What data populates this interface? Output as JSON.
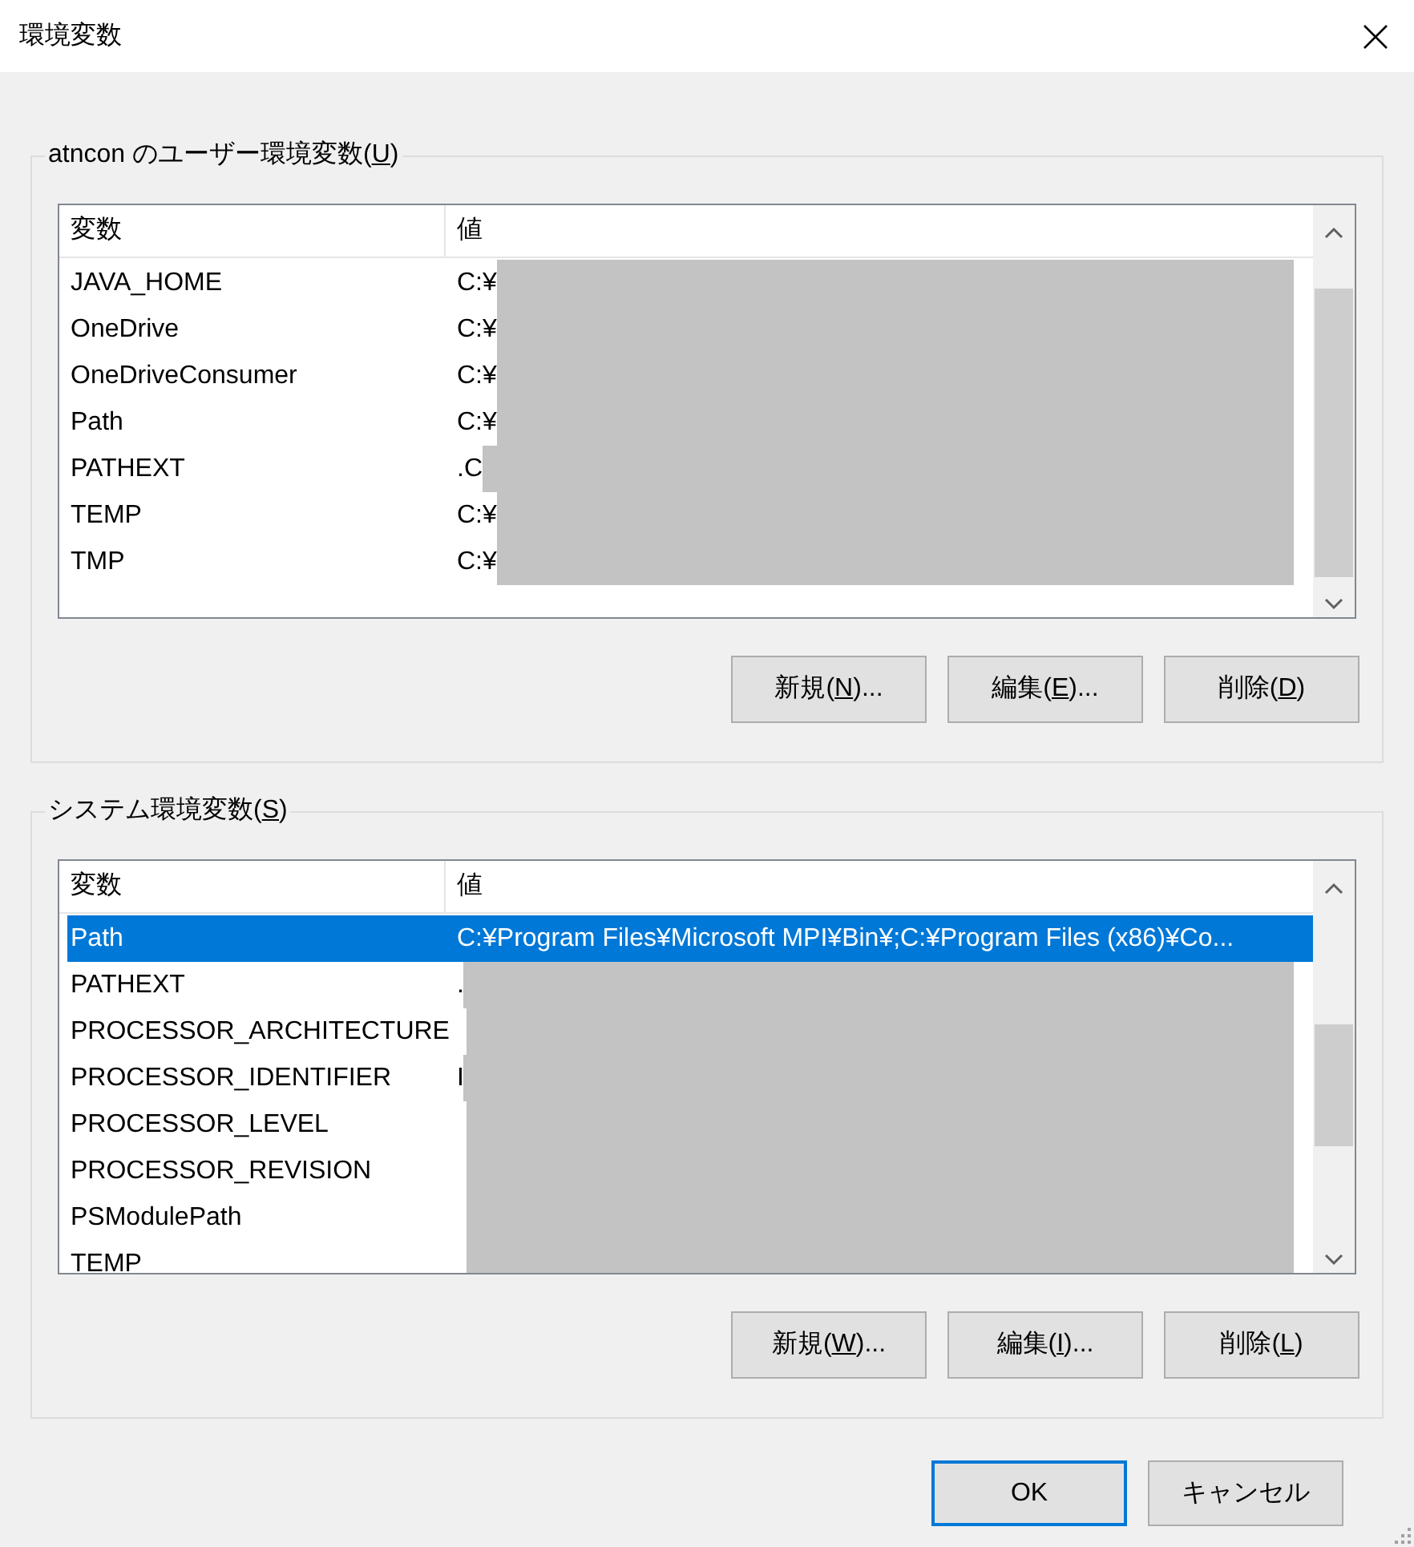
{
  "window": {
    "title": "環境変数"
  },
  "user_group": {
    "legend": {
      "before": "atncon のユーザー環境変数(",
      "accesskey": "U",
      "after": ")"
    },
    "columns": [
      "変数",
      "値"
    ],
    "redacted": true,
    "rows": [
      {
        "name": "JAVA_HOME",
        "value": "C:¥",
        "selected": false
      },
      {
        "name": "OneDrive",
        "value": "C:¥",
        "selected": false
      },
      {
        "name": "OneDriveConsumer",
        "value": "C:¥",
        "selected": false
      },
      {
        "name": "Path",
        "value": "C:¥",
        "selected": false
      },
      {
        "name": "PATHEXT",
        "value": ".C",
        "selected": false
      },
      {
        "name": "TEMP",
        "value": "C:¥",
        "selected": false
      },
      {
        "name": "TMP",
        "value": "C:¥",
        "selected": false
      }
    ],
    "buttons": [
      {
        "before": "新規(",
        "accesskey": "N",
        "after": ")..."
      },
      {
        "before": "編集(",
        "accesskey": "E",
        "after": ")..."
      },
      {
        "before": "削除(",
        "accesskey": "D",
        "after": ")"
      }
    ]
  },
  "system_group": {
    "legend": {
      "before": "システム環境変数(",
      "accesskey": "S",
      "after": ")"
    },
    "columns": [
      "変数",
      "値"
    ],
    "redacted": true,
    "rows": [
      {
        "name": "Path",
        "value": "C:¥Program Files¥Microsoft MPI¥Bin¥;C:¥Program Files (x86)¥Co...",
        "selected": true
      },
      {
        "name": "PATHEXT",
        "value": ".",
        "selected": false
      },
      {
        "name": "PROCESSOR_ARCHITECTURE",
        "selected": false
      },
      {
        "name": "PROCESSOR_IDENTIFIER",
        "value": "I",
        "selected": false
      },
      {
        "name": "PROCESSOR_LEVEL",
        "selected": false
      },
      {
        "name": "PROCESSOR_REVISION",
        "selected": false
      },
      {
        "name": "PSModulePath",
        "selected": false
      },
      {
        "name": "TEMP",
        "selected": false
      }
    ],
    "buttons": [
      {
        "before": "新規(",
        "accesskey": "W",
        "after": ")..."
      },
      {
        "before": "編集(",
        "accesskey": "I",
        "after": ")..."
      },
      {
        "before": "削除(",
        "accesskey": "L",
        "after": ")"
      }
    ]
  },
  "footer_buttons": [
    {
      "label": "OK",
      "default": true
    },
    {
      "label": "キャンセル",
      "default": false
    }
  ]
}
